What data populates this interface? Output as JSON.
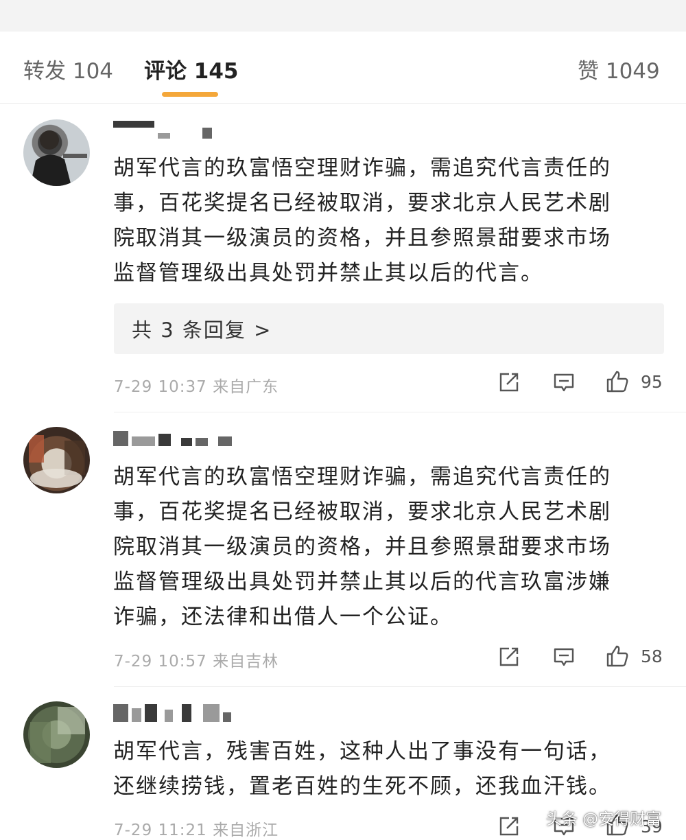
{
  "tabs": [
    {
      "label": "转发 104"
    },
    {
      "label": "评论 145"
    },
    {
      "label": "赞 1049"
    }
  ],
  "accent_color": "#f4a73a",
  "comments": [
    {
      "text": "胡军代言的玖富悟空理财诈骗，需追究代言责任的\n事，百花奖提名已经被取消，要求北京人民艺术剧\n院取消其一级演员的资格，并且参照景甜要求市场\n监督管理级出具处罚并禁止其以后的代言。",
      "reply_label": "共 3 条回复 >",
      "meta": "7-29 10:37 来自广东",
      "likes": "95"
    },
    {
      "text": "胡军代言的玖富悟空理财诈骗，需追究代言责任的\n事，百花奖提名已经被取消，要求北京人民艺术剧\n院取消其一级演员的资格，并且参照景甜要求市场\n监督管理级出具处罚并禁止其以后的代言玖富涉嫌\n诈骗，还法律和出借人一个公证。",
      "meta": "7-29 10:57 来自吉林",
      "likes": "58"
    },
    {
      "text": "胡军代言，残害百姓，这种人出了事没有一句话，\n还继续捞钱，置老百姓的生死不顾，还我血汗钱。",
      "meta": "7-29 11:21 来自浙江",
      "likes": "39"
    }
  ],
  "icons": [
    "share-icon",
    "comment-icon",
    "like-icon"
  ],
  "watermark": "头条 @安得财富"
}
